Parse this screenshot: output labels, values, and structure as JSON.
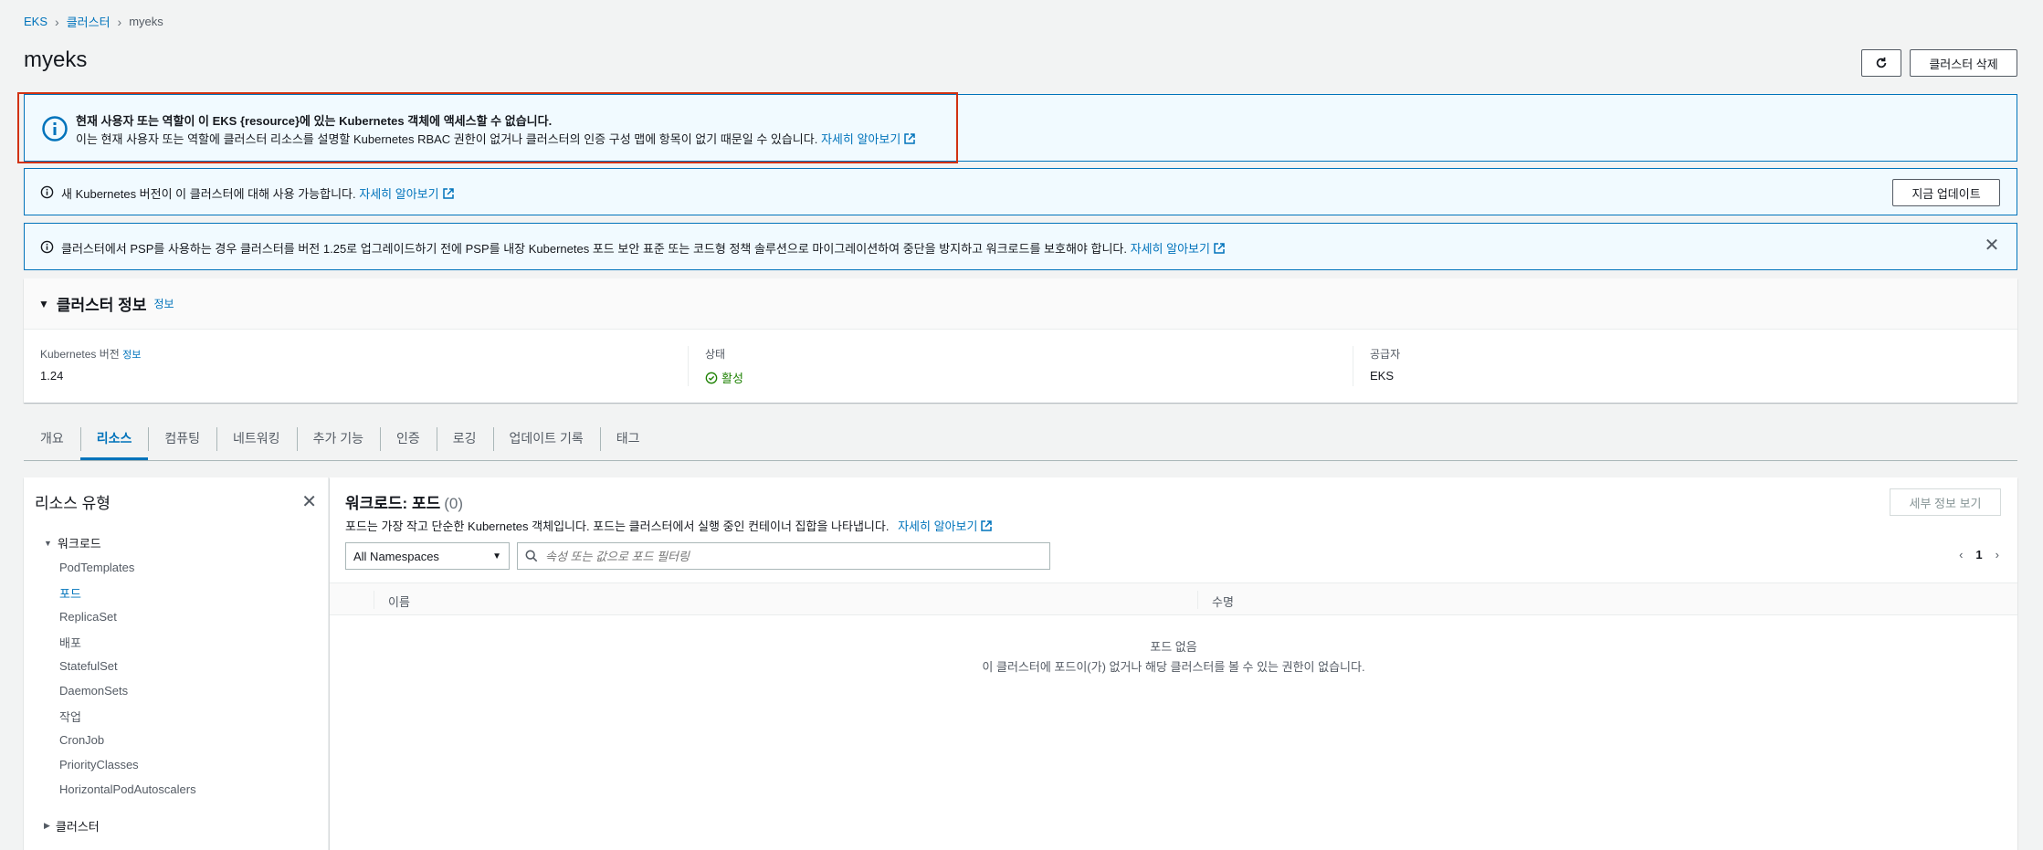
{
  "breadcrumb": {
    "root": "EKS",
    "clusters": "클러스터",
    "current": "myeks"
  },
  "page_title": "myeks",
  "header": {
    "delete_label": "클러스터 삭제"
  },
  "alerts": {
    "access": {
      "title": "현재 사용자 또는 역할이 이 EKS {resource}에 있는 Kubernetes 객체에 액세스할 수 없습니다.",
      "desc": "이는 현재 사용자 또는 역할에 클러스터 리소스를 설명할 Kubernetes RBAC 권한이 없거나 클러스터의 인증 구성 맵에 항목이 없기 때문일 수 있습니다.",
      "link": "자세히 알아보기"
    },
    "version": {
      "text": "새 Kubernetes 버전이 이 클러스터에 대해 사용 가능합니다.",
      "link": "자세히 알아보기",
      "button": "지금 업데이트"
    },
    "psp": {
      "text": "클러스터에서 PSP를 사용하는 경우 클러스터를 버전 1.25로 업그레이드하기 전에 PSP를 내장 Kubernetes 포드 보안 표준 또는 코드형 정책 솔루션으로 마이그레이션하여 중단을 방지하고 워크로드를 보호해야 합니다.",
      "link": "자세히 알아보기"
    }
  },
  "cluster_info": {
    "title": "클러스터 정보",
    "info_link": "정보",
    "k8s_version_label": "Kubernetes 버전",
    "k8s_version_info": "정보",
    "k8s_version": "1.24",
    "status_label": "상태",
    "status": "활성",
    "provider_label": "공급자",
    "provider": "EKS"
  },
  "tabs": [
    "개요",
    "리소스",
    "컴퓨팅",
    "네트워킹",
    "추가 기능",
    "인증",
    "로깅",
    "업데이트 기록",
    "태그"
  ],
  "active_tab": "리소스",
  "side_nav": {
    "title": "리소스 유형",
    "workloads_label": "워크로드",
    "items": [
      "PodTemplates",
      "포드",
      "ReplicaSet",
      "배포",
      "StatefulSet",
      "DaemonSets",
      "작업",
      "CronJob",
      "PriorityClasses",
      "HorizontalPodAutoscalers"
    ],
    "active_item": "포드",
    "cluster_label": "클러스터"
  },
  "content": {
    "title": "워크로드: 포드",
    "count": "(0)",
    "desc": "포드는 가장 작고 단순한 Kubernetes 객체입니다. 포드는 클러스터에서 실행 중인 컨테이너 집합을 나타냅니다.",
    "link": "자세히 알아보기",
    "details_button": "세부 정보 보기",
    "namespace": "All Namespaces",
    "search_placeholder": "속성 또는 값으로 포드 필터링",
    "page": "1",
    "col_name": "이름",
    "col_age": "수명",
    "empty_title": "포드 없음",
    "empty_desc": "이 클러스터에 포드이(가) 없거나 해당 클러스터를 볼 수 있는 권한이 없습니다."
  }
}
